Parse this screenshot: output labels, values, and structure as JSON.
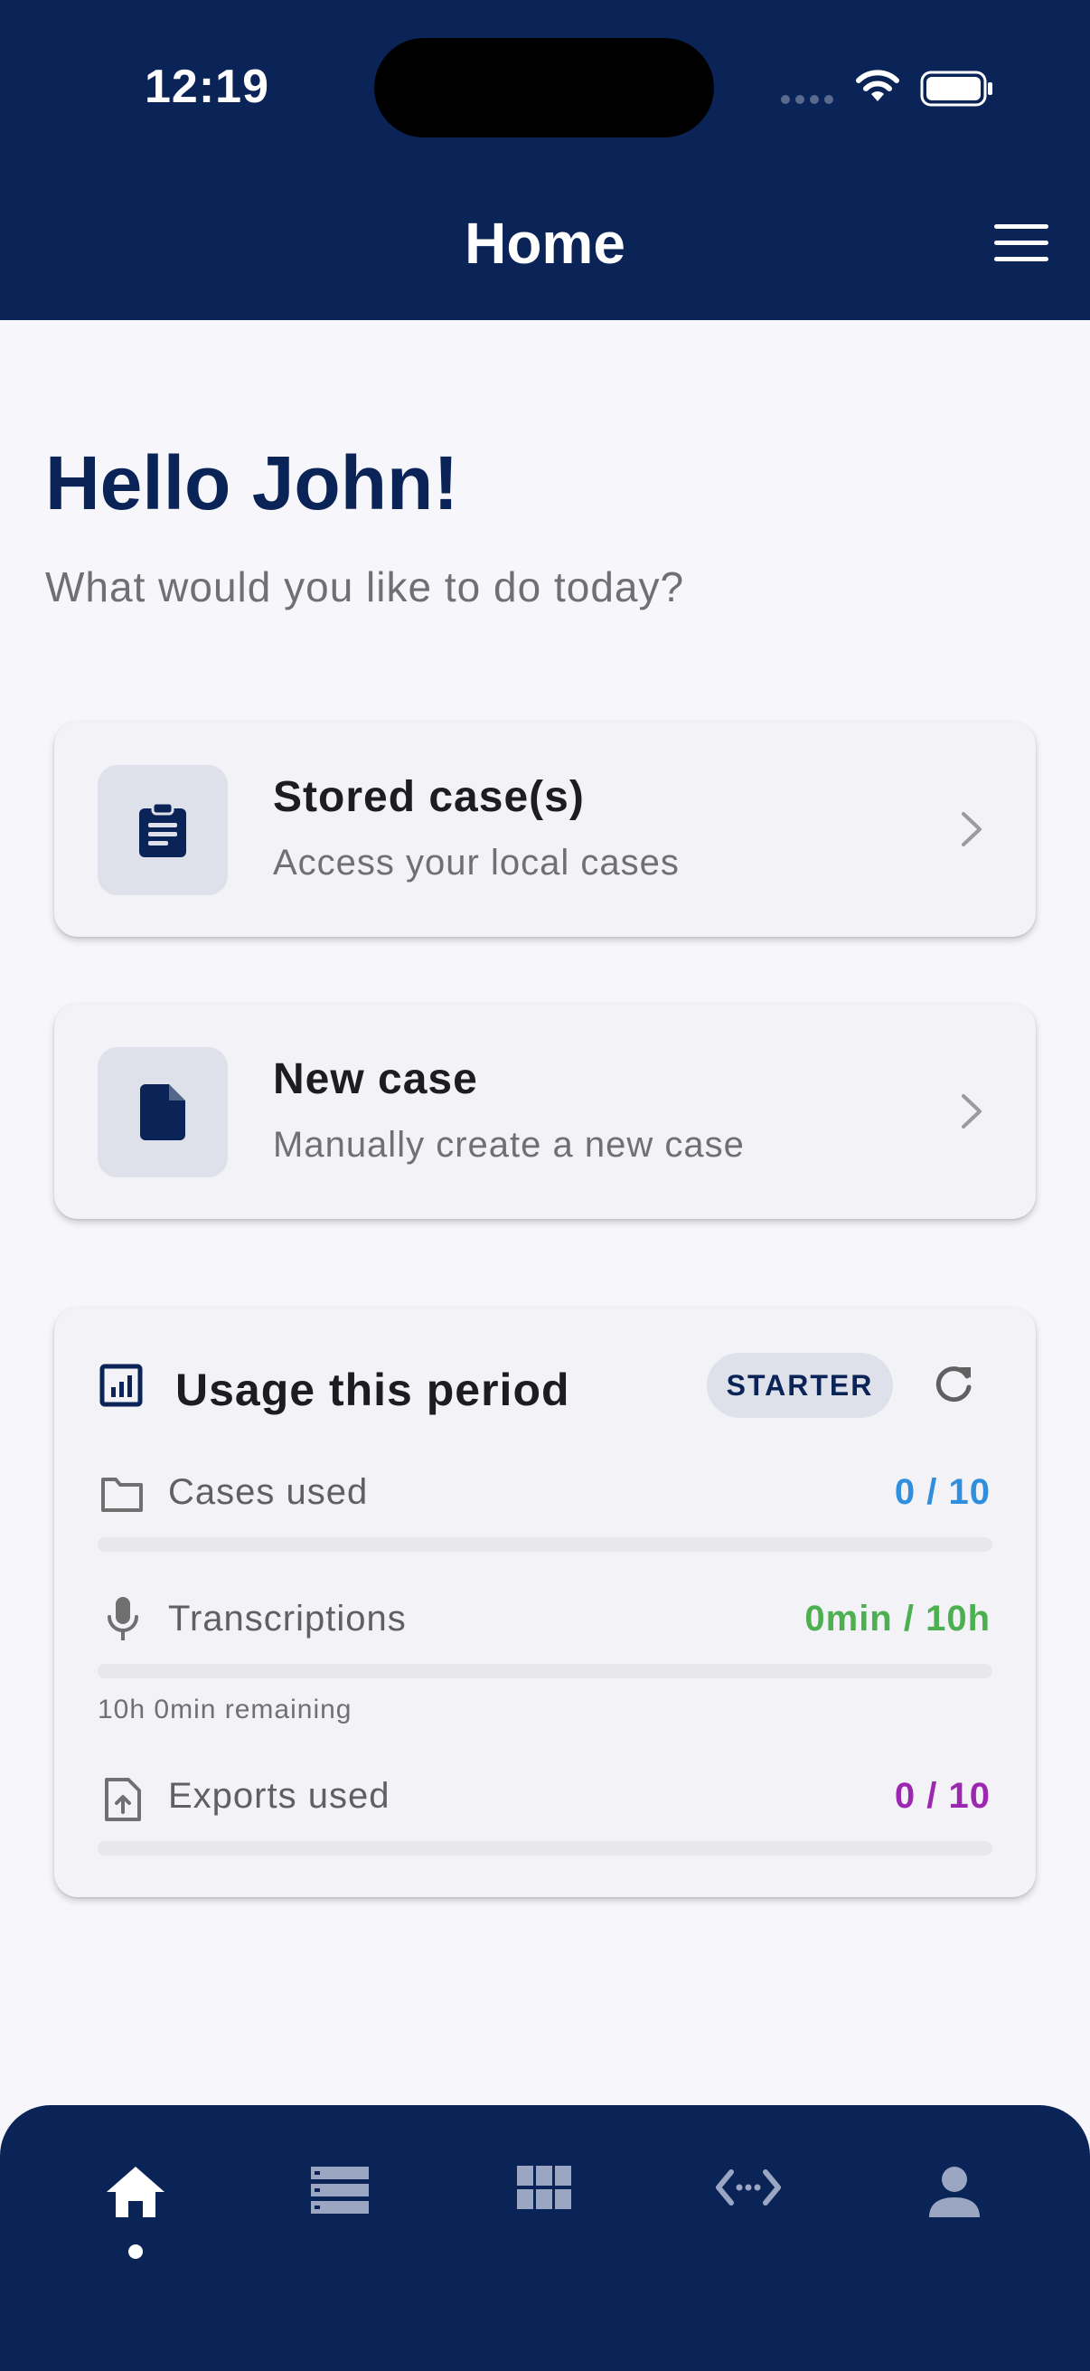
{
  "status_bar": {
    "time": "12:19"
  },
  "header": {
    "title": "Home"
  },
  "greeting": {
    "title": "Hello John!",
    "subtitle": "What would you like to do today?"
  },
  "actions": [
    {
      "title": "Stored case(s)",
      "subtitle": "Access your local cases",
      "icon": "clipboard-icon"
    },
    {
      "title": "New case",
      "subtitle": "Manually create a new case",
      "icon": "document-icon"
    }
  ],
  "usage": {
    "title": "Usage this period",
    "plan_badge": "STARTER",
    "metrics": [
      {
        "label": "Cases used",
        "value": "0 / 10",
        "progress": 0,
        "color": "#2f8fdc",
        "icon": "folder-icon"
      },
      {
        "label": "Transcriptions",
        "value": "0min / 10h",
        "progress": 0,
        "color": "#4caf50",
        "icon": "microphone-icon"
      },
      {
        "label": "Exports used",
        "value": "0 / 10",
        "progress": 0,
        "color": "#9c27b0",
        "icon": "file-upload-icon"
      }
    ],
    "remaining_note": "10h 0min remaining"
  },
  "bottom_nav": {
    "items": [
      "home-icon",
      "list-icon",
      "grid-icon",
      "code-icon",
      "person-icon"
    ],
    "active": "home-icon"
  },
  "colors": {
    "primary": "#0a2457",
    "background": "#f6f6fb",
    "card": "#f2f2f7"
  }
}
